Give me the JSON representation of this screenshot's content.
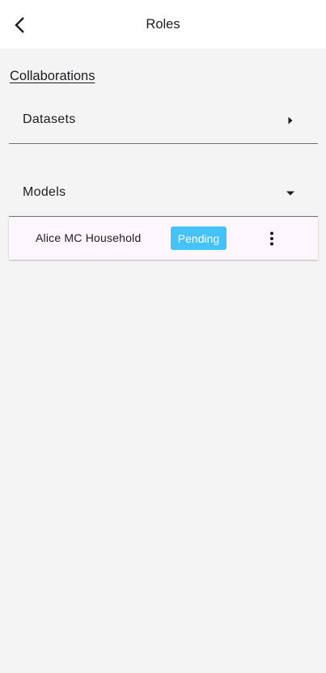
{
  "app_bar": {
    "title": "Roles",
    "back_icon": "chevron-left-icon"
  },
  "section": {
    "title": "Collaborations"
  },
  "expanders": [
    {
      "label": "Datasets",
      "expanded": false,
      "icon": "caret-right-icon"
    },
    {
      "label": "Models",
      "expanded": true,
      "icon": "caret-down-icon"
    }
  ],
  "models_list": [
    {
      "name": "Alice MC Household",
      "status": "Pending",
      "status_color": "#45c2f7",
      "menu_icon": "more-vertical-icon"
    }
  ],
  "colors": {
    "background": "#f4f4f4",
    "app_bar": "#ffffff",
    "item_background": "#fdf7fd",
    "pending_badge": "#45c2f7"
  }
}
